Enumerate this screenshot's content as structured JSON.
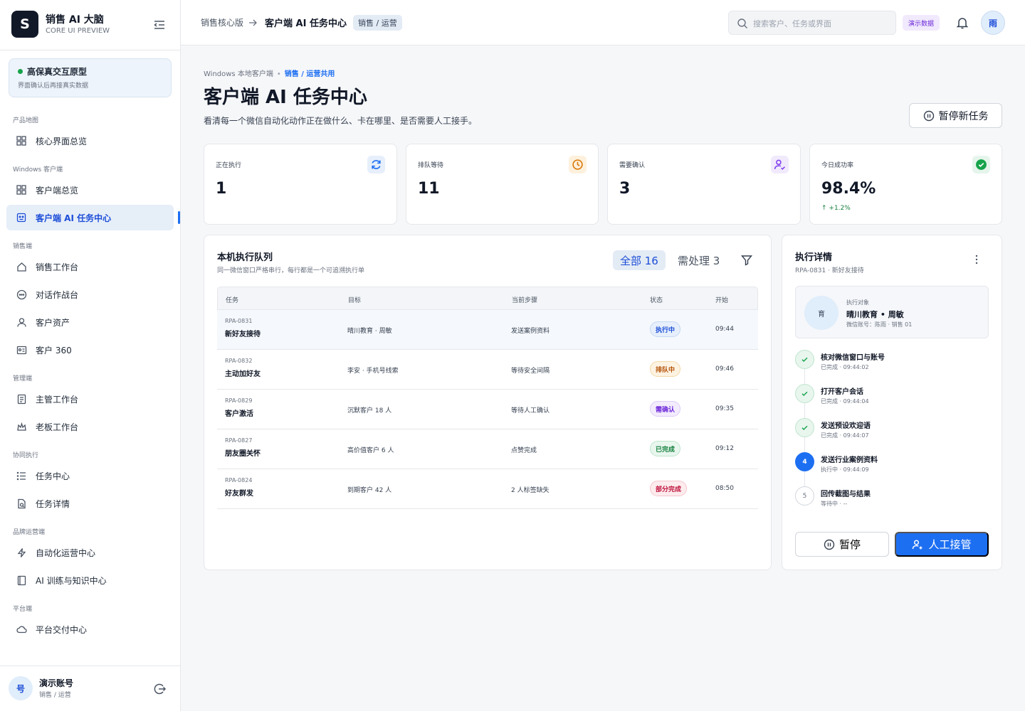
{
  "brand": {
    "logo": "S",
    "title": "销售 AI 大脑",
    "subtitle": "CORE UI PREVIEW"
  },
  "prototype": {
    "title": "高保真交互原型",
    "subtitle": "界面确认后再接真实数据"
  },
  "sidebar": {
    "groups": [
      {
        "label": "产品地图",
        "items": [
          {
            "label": "核心界面总览",
            "icon": "grid-icon"
          }
        ]
      },
      {
        "label": "Windows 客户端",
        "items": [
          {
            "label": "客户端总览",
            "icon": "grid-icon"
          },
          {
            "label": "客户端 AI 任务中心",
            "icon": "monitor-robot-icon",
            "active": true
          }
        ]
      },
      {
        "label": "销售端",
        "items": [
          {
            "label": "销售工作台",
            "icon": "home-icon"
          },
          {
            "label": "对话作战台",
            "icon": "chat-icon"
          },
          {
            "label": "客户资产",
            "icon": "user-icon"
          },
          {
            "label": "客户 360",
            "icon": "id-card-icon"
          }
        ]
      },
      {
        "label": "管理端",
        "items": [
          {
            "label": "主管工作台",
            "icon": "clipboard-icon"
          },
          {
            "label": "老板工作台",
            "icon": "crown-icon"
          }
        ]
      },
      {
        "label": "协同执行",
        "items": [
          {
            "label": "任务中心",
            "icon": "list-icon"
          },
          {
            "label": "任务详情",
            "icon": "file-search-icon"
          }
        ]
      },
      {
        "label": "品牌运营端",
        "items": [
          {
            "label": "自动化运营中心",
            "icon": "zap-icon"
          },
          {
            "label": "AI 训练与知识中心",
            "icon": "book-icon"
          }
        ]
      },
      {
        "label": "平台端",
        "items": [
          {
            "label": "平台交付中心",
            "icon": "cloud-icon"
          }
        ]
      }
    ]
  },
  "account": {
    "avatar": "号",
    "name": "演示账号",
    "role": "销售 / 运营"
  },
  "topbar": {
    "breadcrumb_root": "销售核心版",
    "breadcrumb_current": "客户端 AI 任务中心",
    "role_badge": "销售 / 运营",
    "search_placeholder": "搜索客户、任务或界面",
    "demo_badge": "演示数据",
    "user_avatar": "雨"
  },
  "header": {
    "kicker": "Windows 本地客户端",
    "kicker_highlight": "销售 / 运营共用",
    "title": "客户端 AI 任务中心",
    "description": "看清每一个微信自动化动作正在做什么、卡在哪里、是否需要人工接手。",
    "pause_new_label": "暂停新任务"
  },
  "stats": [
    {
      "label": "正在执行",
      "value": "1",
      "icon": "refresh-icon",
      "color": "#1d6ff2"
    },
    {
      "label": "排队等待",
      "value": "11",
      "icon": "clock-icon",
      "color": "#d97706"
    },
    {
      "label": "需要确认",
      "value": "3",
      "icon": "user-check-icon",
      "color": "#7c3aed"
    },
    {
      "label": "今日成功率",
      "value": "98.4%",
      "delta": "↑ +1.2%",
      "icon": "check-circle-icon",
      "color": "#16a34a"
    }
  ],
  "queue": {
    "title": "本机执行队列",
    "subtitle": "同一微信窗口严格串行，每行都是一个可追溯执行单",
    "tab_all": "全部 16",
    "tab_todo": "需处理 3",
    "columns": [
      "任务",
      "目标",
      "当前步骤",
      "状态",
      "开始"
    ],
    "rows": [
      {
        "id": "RPA-0831",
        "name": "新好友接待",
        "target": "晴川教育 · 周敏",
        "step": "发送案例资料",
        "status": "执行中",
        "status_kind": "running",
        "time": "09:44"
      },
      {
        "id": "RPA-0832",
        "name": "主动加好友",
        "target": "李安 · 手机号线索",
        "step": "等待安全间隔",
        "status": "排队中",
        "status_kind": "queued",
        "time": "09:46"
      },
      {
        "id": "RPA-0829",
        "name": "客户激活",
        "target": "沉默客户 18 人",
        "step": "等待人工确认",
        "status": "需确认",
        "status_kind": "confirm",
        "time": "09:35"
      },
      {
        "id": "RPA-0827",
        "name": "朋友圈关怀",
        "target": "高价值客户 6 人",
        "step": "点赞完成",
        "status": "已完成",
        "status_kind": "done",
        "time": "09:12"
      },
      {
        "id": "RPA-0824",
        "name": "好友群发",
        "target": "到期客户 42 人",
        "step": "2 人标签缺失",
        "status": "部分完成",
        "status_kind": "partial",
        "time": "08:50"
      }
    ]
  },
  "detail": {
    "title": "执行详情",
    "subtitle": "RPA-0831 · 新好友接待",
    "target_avatar": "育",
    "target_label": "执行对象",
    "target_name": "晴川教育 • 周敏",
    "target_wechat": "微信账号：陈雨 · 销售 01",
    "steps": [
      {
        "title": "核对微信窗口与账号",
        "meta": "已完成 · 09:44:02",
        "state": "done",
        "marker": "✓"
      },
      {
        "title": "打开客户会话",
        "meta": "已完成 · 09:44:04",
        "state": "done",
        "marker": "✓"
      },
      {
        "title": "发送预设欢迎语",
        "meta": "已完成 · 09:44:07",
        "state": "done",
        "marker": "✓"
      },
      {
        "title": "发送行业案例资料",
        "meta": "执行中 · 09:44:09",
        "state": "cur",
        "marker": "4"
      },
      {
        "title": "回传截图与结果",
        "meta": "等待中 · --",
        "state": "wait",
        "marker": "5"
      }
    ],
    "pause_label": "暂停",
    "takeover_label": "人工接管"
  },
  "colors": {
    "accent": "#1d6ff2",
    "sidebar_active_bg": "#e6eef8",
    "success": "#16a34a"
  }
}
